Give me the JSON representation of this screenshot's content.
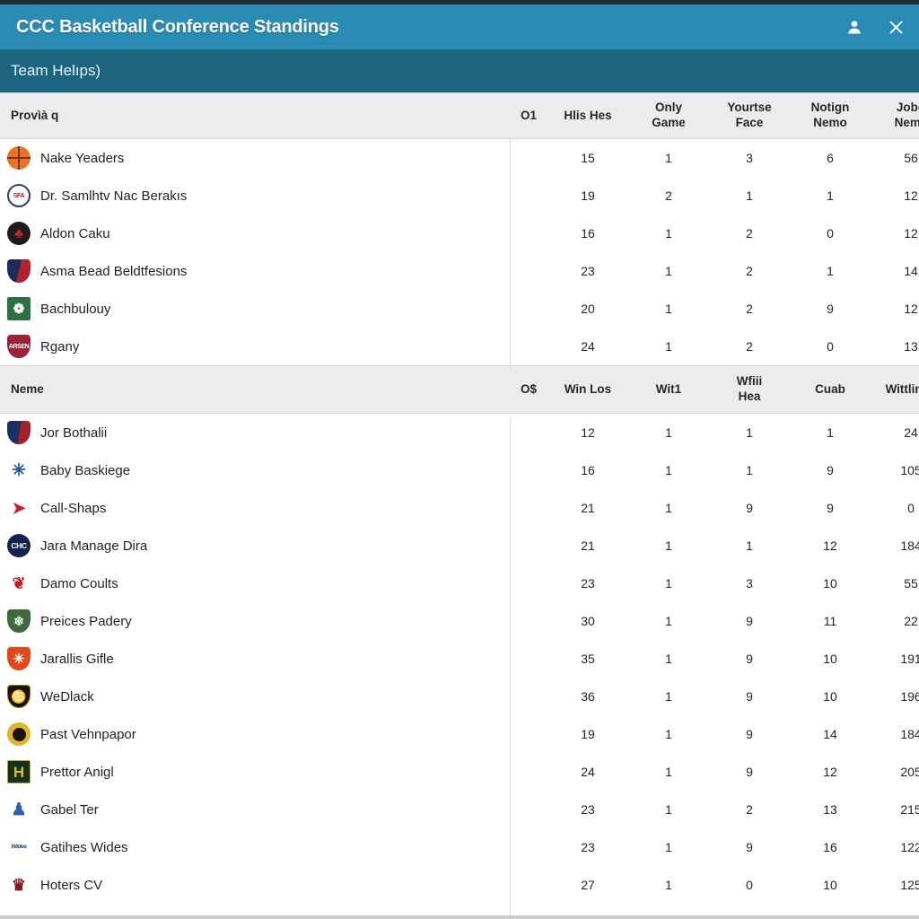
{
  "window": {
    "title": "CCC Basketball Conference Standings",
    "subtitle": "Team Helıps)",
    "accent_color": "#2a8bb5",
    "subbar_color": "#1d6480",
    "header_row_color": "#ececec",
    "user_icon": "user-icon",
    "close_icon": "close-icon"
  },
  "sections": [
    {
      "id": "section-1",
      "headers": {
        "name": "Provìà q",
        "rank": "O1",
        "col_a": "Hlis Hes",
        "col_b": "Only\nGame",
        "col_c": "Yourtse\nFace",
        "col_d": "Notign\nNemo",
        "col_e": "Jobg\nNeme"
      },
      "rows": [
        {
          "logo": "basketball-logo",
          "team": "Nake Yeaders",
          "rank": "",
          "a": "15",
          "b": "1",
          "c": "3",
          "d": "6",
          "e": "56"
        },
        {
          "logo": "crest-white-logo",
          "team": "Dr. Samlhtv Nac Berakıs",
          "rank": "",
          "a": "19",
          "b": "2",
          "c": "1",
          "d": "1",
          "e": "12"
        },
        {
          "logo": "dark-red-logo",
          "team": "Aldon Caku",
          "rank": "",
          "a": "16",
          "b": "1",
          "c": "2",
          "d": "0",
          "e": "12"
        },
        {
          "logo": "navy-red-logo",
          "team": "Asma Bead Beldtfesions",
          "rank": "",
          "a": "23",
          "b": "1",
          "c": "2",
          "d": "1",
          "e": "14"
        },
        {
          "logo": "green-square-logo",
          "team": "Bachbulouy",
          "rank": "",
          "a": "20",
          "b": "1",
          "c": "2",
          "d": "9",
          "e": "12"
        },
        {
          "logo": "maroon-logo",
          "team": "Rgany",
          "rank": "",
          "a": "24",
          "b": "1",
          "c": "2",
          "d": "0",
          "e": "13"
        }
      ]
    },
    {
      "id": "section-2",
      "headers": {
        "name": "Neme",
        "rank": "O$",
        "col_a": "Win Los",
        "col_b": "Wit1",
        "col_c": "Wfiii\nHea",
        "col_d": "Cuab",
        "col_e": "Wittlinge"
      },
      "rows": [
        {
          "logo": "navy-shield-logo",
          "team": "Jor Bothalii",
          "rank": "",
          "a": "12",
          "b": "1",
          "c": "1",
          "d": "1",
          "e": "24"
        },
        {
          "logo": "blue-figure-logo",
          "team": "Baby Baskiege",
          "rank": "",
          "a": "16",
          "b": "1",
          "c": "1",
          "d": "9",
          "e": "105"
        },
        {
          "logo": "bird-logo",
          "team": "Call-Shaps",
          "rank": "",
          "a": "21",
          "b": "1",
          "c": "9",
          "d": "9",
          "e": "0"
        },
        {
          "logo": "chc-logo",
          "team": "Jara Manage Dira",
          "rank": "",
          "a": "21",
          "b": "1",
          "c": "1",
          "d": "12",
          "e": "184"
        },
        {
          "logo": "ram-logo",
          "team": "Damo Coults",
          "rank": "",
          "a": "23",
          "b": "1",
          "c": "3",
          "d": "10",
          "e": "55"
        },
        {
          "logo": "green-shield-logo",
          "team": "Preices Padery",
          "rank": "",
          "a": "30",
          "b": "1",
          "c": "9",
          "d": "11",
          "e": "22"
        },
        {
          "logo": "orange-shield-logo",
          "team": "Jarallis Gifle",
          "rank": "",
          "a": "35",
          "b": "1",
          "c": "9",
          "d": "10",
          "e": "191"
        },
        {
          "logo": "black-gold-logo",
          "team": "WeDlack",
          "rank": "",
          "a": "36",
          "b": "1",
          "c": "9",
          "d": "10",
          "e": "196"
        },
        {
          "logo": "gold-circle-logo",
          "team": "Past Vehnpapor",
          "rank": "",
          "a": "19",
          "b": "1",
          "c": "9",
          "d": "14",
          "e": "184"
        },
        {
          "logo": "h-gold-logo",
          "team": "Prettor Anigl",
          "rank": "",
          "a": "24",
          "b": "1",
          "c": "9",
          "d": "12",
          "e": "205"
        },
        {
          "logo": "blue-statue-logo",
          "team": "Gabel Ter",
          "rank": "",
          "a": "23",
          "b": "1",
          "c": "2",
          "d": "13",
          "e": "215"
        },
        {
          "logo": "script-logo",
          "team": "Gatihes Wides",
          "rank": "",
          "a": "23",
          "b": "1",
          "c": "9",
          "d": "16",
          "e": "122"
        },
        {
          "logo": "dark-jug-logo",
          "team": "Hoters CV",
          "rank": "",
          "a": "27",
          "b": "1",
          "c": "0",
          "d": "10",
          "e": "125"
        }
      ]
    }
  ],
  "logo_glyphs": {
    "basketball-logo": {
      "class": "lg-basketball lg-circle",
      "glyph": "",
      "inner": ""
    },
    "crest-white-logo": {
      "class": "lg-crest-white lg-circle",
      "glyph": "",
      "inner": "SFA"
    },
    "dark-red-logo": {
      "class": "lg-dark-red lg-circle",
      "glyph": "♣",
      "inner": ""
    },
    "navy-red-logo": {
      "class": "lg-navy-red lg-shield",
      "glyph": "",
      "inner": ""
    },
    "green-square-logo": {
      "class": "lg-green-sq lg-square",
      "glyph": "❁",
      "inner": ""
    },
    "maroon-logo": {
      "class": "lg-maroon lg-shield",
      "glyph": "",
      "inner": "ARSEN"
    },
    "navy-shield-logo": {
      "class": "lg-navy-shield lg-shield",
      "glyph": "",
      "inner": ""
    },
    "blue-figure-logo": {
      "class": "lg-blue-fig",
      "glyph": "✳",
      "inner": ""
    },
    "bird-logo": {
      "class": "lg-bird",
      "glyph": "➤",
      "inner": ""
    },
    "chc-logo": {
      "class": "lg-chc lg-circle",
      "glyph": "",
      "inner": "CHC"
    },
    "ram-logo": {
      "class": "lg-ram lg-shield",
      "glyph": "❦",
      "inner": ""
    },
    "green-shield-logo": {
      "class": "lg-green-shield lg-shield",
      "glyph": "❄",
      "inner": ""
    },
    "orange-shield-logo": {
      "class": "lg-orange-shield lg-shield",
      "glyph": "✳",
      "inner": ""
    },
    "black-gold-logo": {
      "class": "lg-black-gold lg-shield",
      "glyph": "♋",
      "inner": ""
    },
    "gold-circle-logo": {
      "class": "lg-gold-circle lg-circle",
      "glyph": "",
      "inner": ""
    },
    "h-gold-logo": {
      "class": "lg-h-gold lg-square",
      "glyph": "H",
      "inner": ""
    },
    "blue-statue-logo": {
      "class": "lg-blue-stat",
      "glyph": "♟",
      "inner": ""
    },
    "script-logo": {
      "class": "lg-script",
      "glyph": "",
      "inner": "Wides"
    },
    "dark-jug-logo": {
      "class": "lg-dark-jug",
      "glyph": "♛",
      "inner": ""
    }
  }
}
